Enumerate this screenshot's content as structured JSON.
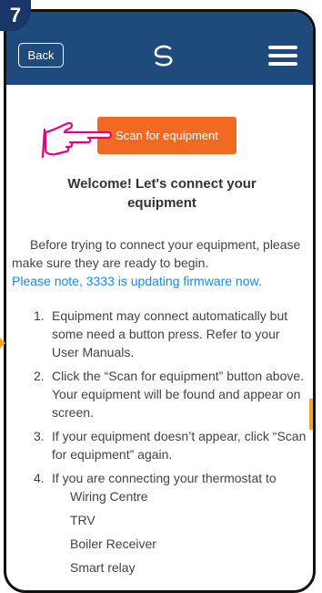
{
  "badge": {
    "number": "7"
  },
  "header": {
    "back_label": "Back"
  },
  "main": {
    "scan_button": "Scan for equipment",
    "welcome_line1": "Welcome! Let's connect your",
    "welcome_line2": "equipment",
    "intro": "Before trying to connect your equipment, please make sure they are ready to begin.",
    "note": "Please note, 3333 is updating firmware now.",
    "steps": [
      {
        "num": "1.",
        "text": "Equipment may connect automatically but some need a button press. Refer to your User Manuals."
      },
      {
        "num": "2.",
        "text": "Click the “Scan for equipment” button above. Your equipment will be found and appear on screen."
      },
      {
        "num": "3.",
        "text": "If your equipment doesn’t appear, click “Scan for equipment” again."
      },
      {
        "num": "4.",
        "text": "If you are connecting your thermostat to",
        "sub": [
          "Wiring Centre",
          "TRV",
          "Boiler Receiver",
          "Smart relay"
        ]
      }
    ]
  },
  "colors": {
    "header": "#1e4a7c",
    "accent": "#f26a21",
    "link": "#1e88e5",
    "badge": "#1a3568",
    "hand": "#e6007e"
  }
}
